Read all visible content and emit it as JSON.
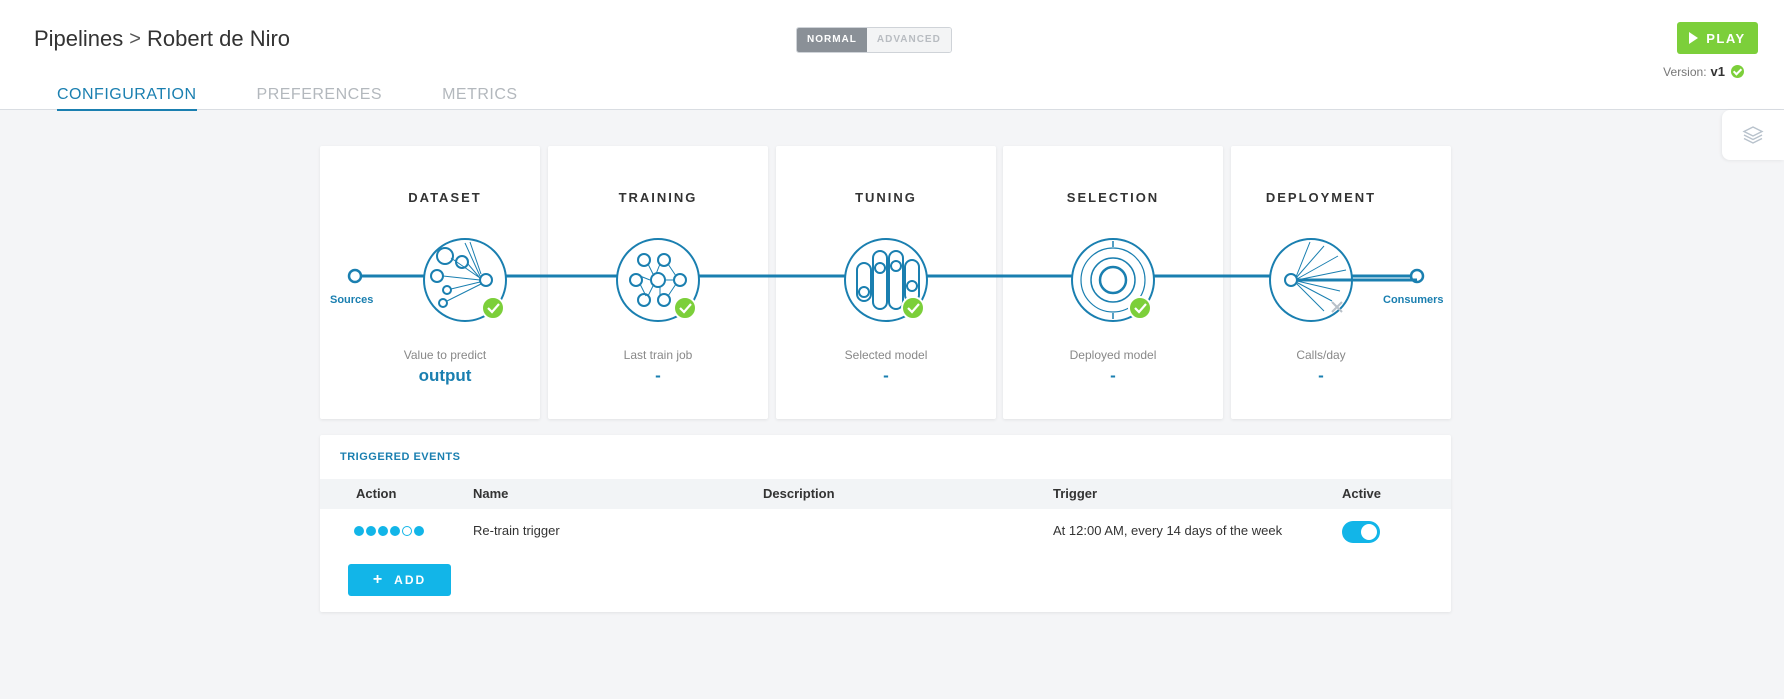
{
  "breadcrumb": {
    "root": "Pipelines",
    "separator": ">",
    "current": "Robert de Niro"
  },
  "mode_toggle": {
    "normal": "NORMAL",
    "advanced": "ADVANCED",
    "selected": "NORMAL"
  },
  "play_button": {
    "label": "PLAY",
    "color": "#7ccf3a"
  },
  "version": {
    "label": "Version:",
    "value": "v1",
    "status_icon": "check-circle-icon"
  },
  "tabs": [
    {
      "label": "CONFIGURATION",
      "active": true
    },
    {
      "label": "PREFERENCES",
      "active": false
    },
    {
      "label": "METRICS",
      "active": false
    }
  ],
  "side_panel": {
    "icon": "layers-icon"
  },
  "pipeline": {
    "sources_label": "Sources",
    "consumers_label": "Consumers",
    "stages": [
      {
        "title": "DATASET",
        "caption": "Value to predict",
        "value": "output",
        "status": "ok",
        "icon": "dataset-icon"
      },
      {
        "title": "TRAINING",
        "caption": "Last train job",
        "value": "-",
        "status": "ok",
        "icon": "neural-network-icon"
      },
      {
        "title": "TUNING",
        "caption": "Selected model",
        "value": "-",
        "status": "ok",
        "icon": "sliders-icon"
      },
      {
        "title": "SELECTION",
        "caption": "Deployed model",
        "value": "-",
        "status": "ok",
        "icon": "target-icon"
      },
      {
        "title": "DEPLOYMENT",
        "caption": "Calls/day",
        "value": "-",
        "status": "none",
        "icon": "deployment-icon"
      }
    ]
  },
  "triggered_events": {
    "title": "TRIGGERED EVENTS",
    "columns": {
      "action": "Action",
      "name": "Name",
      "description": "Description",
      "trigger": "Trigger",
      "active": "Active"
    },
    "rows": [
      {
        "action_icon": "pipeline-steps-icon",
        "name": "Re-train trigger",
        "description": "",
        "trigger": "At 12:00 AM, every 14 days of the week",
        "active": true
      }
    ],
    "add_button": {
      "icon": "+",
      "label": "ADD"
    }
  },
  "colors": {
    "accent": "#1a7fb0",
    "success": "#7ccf3a",
    "cyan": "#12b5e8"
  }
}
